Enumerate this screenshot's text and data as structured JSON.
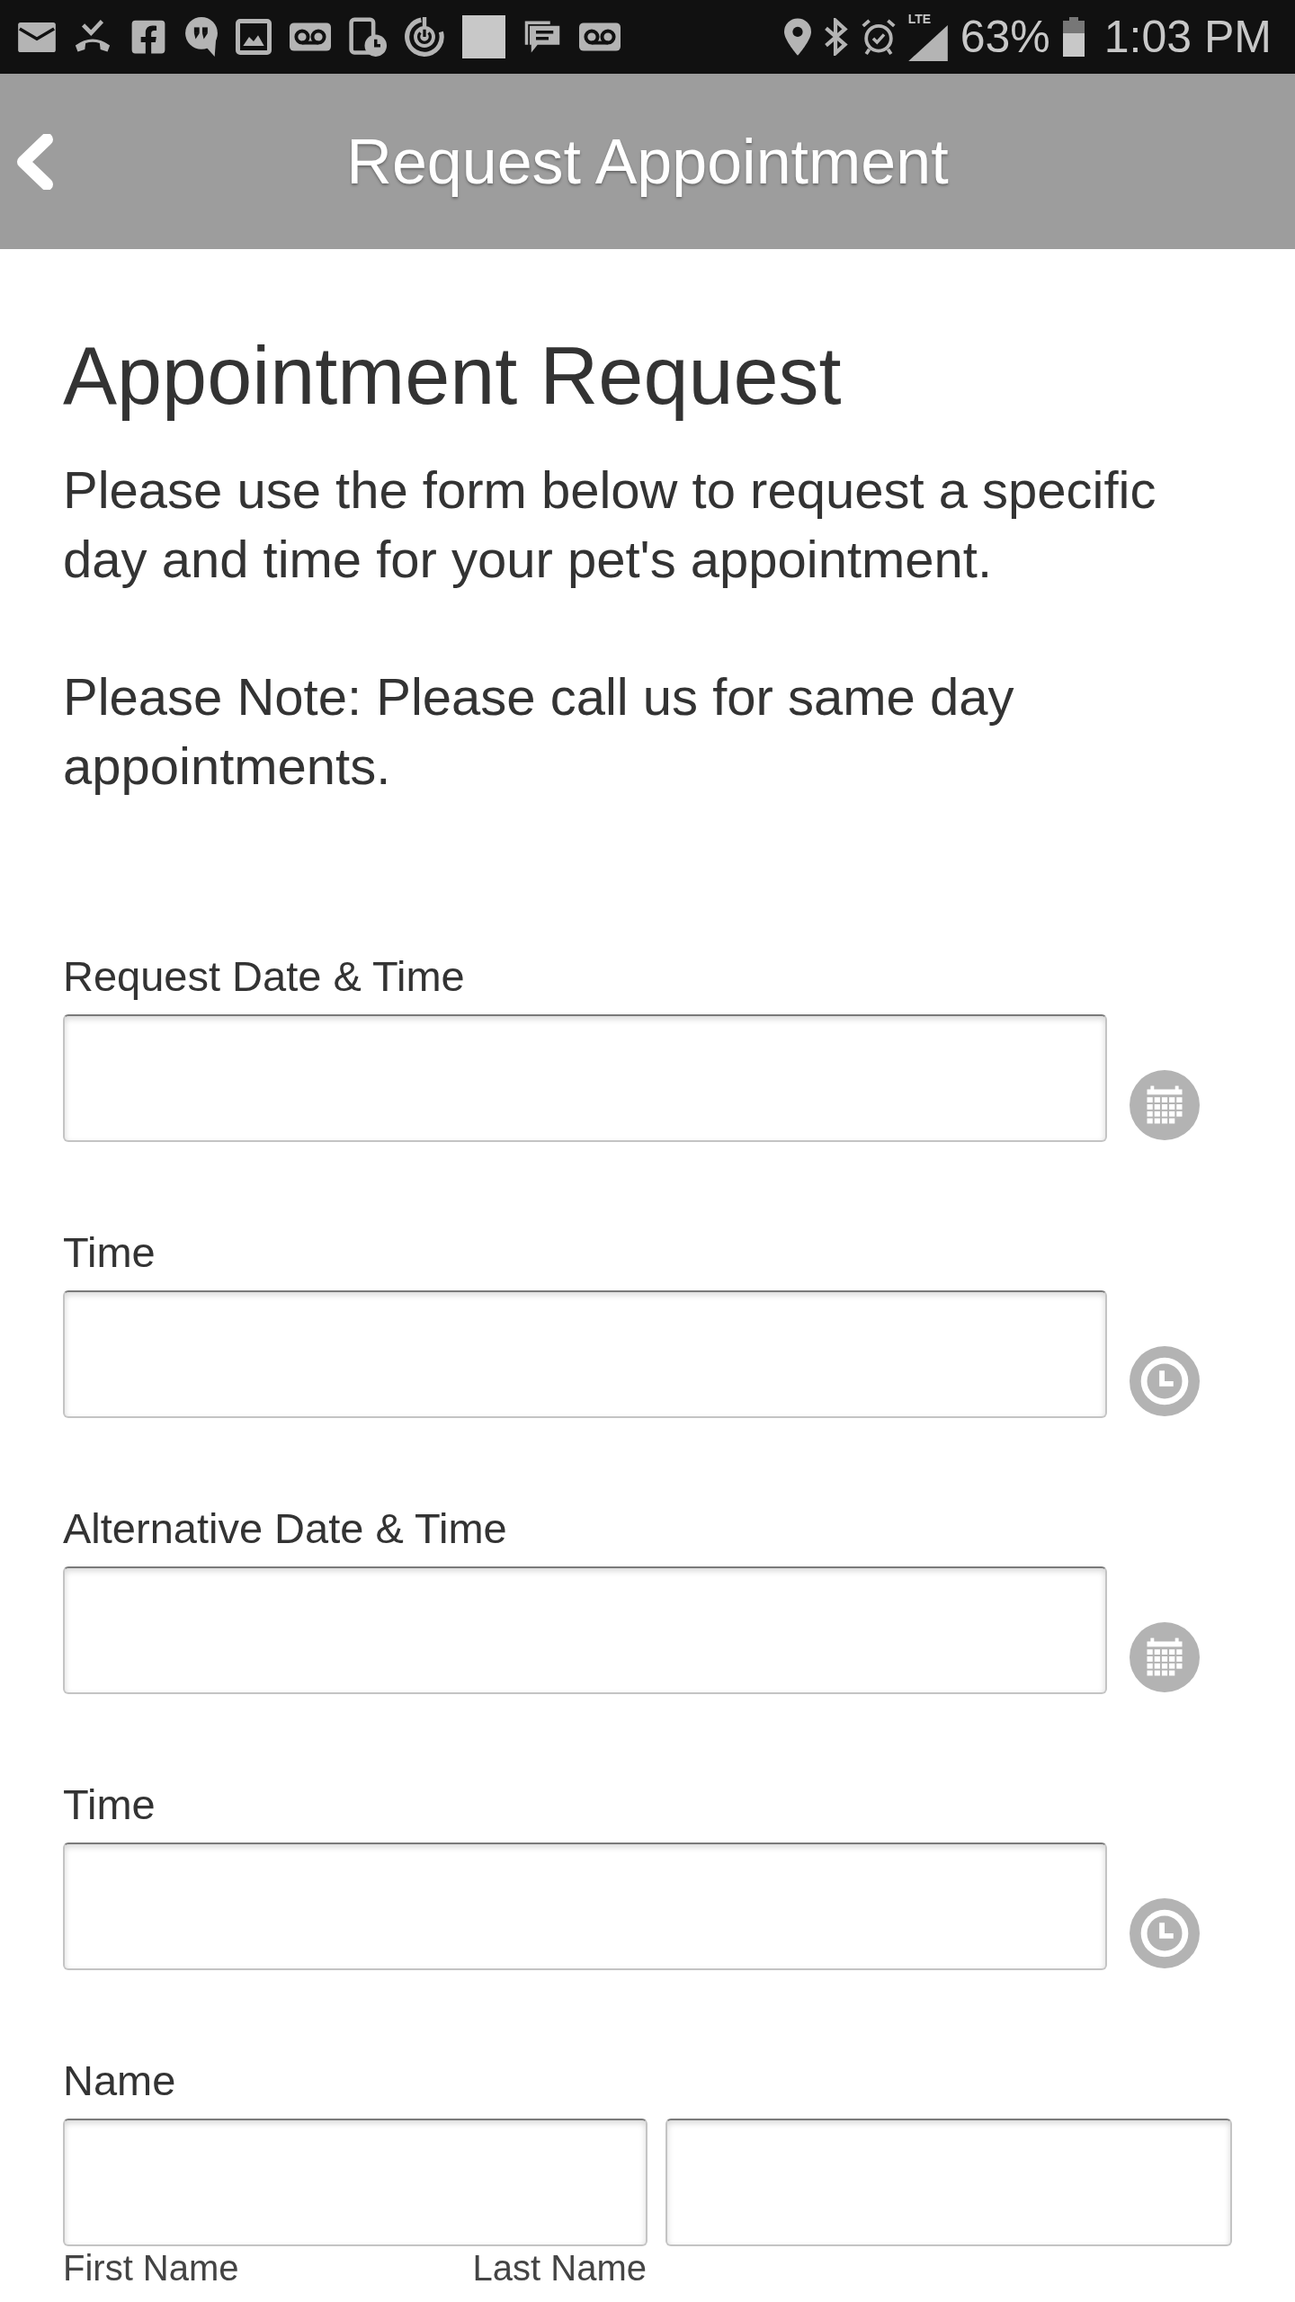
{
  "status_bar": {
    "network_type": "LTE",
    "battery": "63%",
    "time": "1:03 PM"
  },
  "header": {
    "title": "Request Appointment"
  },
  "content": {
    "heading": "Appointment Request",
    "paragraphs": [
      "Please use the form below to request a specific day and time for your pet's appointment.",
      "Please Note: Please call us for same day appointments."
    ]
  },
  "form": {
    "fields": [
      {
        "label": "Request Date & Time",
        "kind": "date"
      },
      {
        "label": "Time",
        "kind": "time"
      },
      {
        "label": "Alternative Date & Time",
        "kind": "date"
      },
      {
        "label": "Time",
        "kind": "time"
      },
      {
        "label": "Name",
        "kind": "name",
        "subfields": [
          "First Name",
          "Last Name"
        ]
      }
    ]
  }
}
